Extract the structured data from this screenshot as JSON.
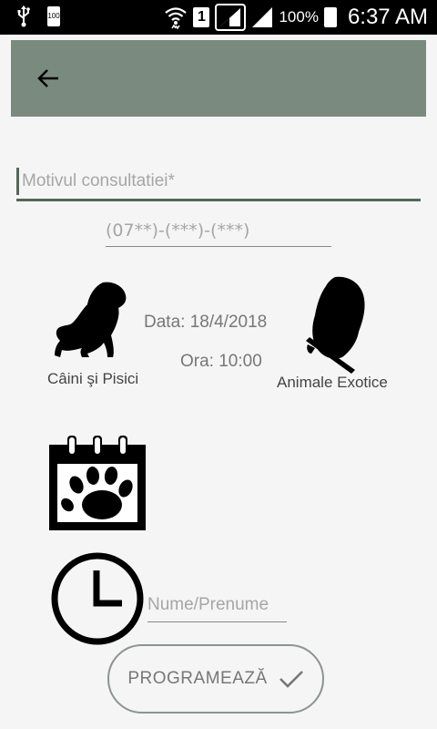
{
  "status_bar": {
    "left_icons": [
      "usb-icon",
      "battery-100-icon"
    ],
    "battery_small_text": "100",
    "sim_number": "1",
    "battery_percent": "100%",
    "time": "6:37 AM"
  },
  "toolbar": {
    "back_icon": "arrow-left-icon",
    "color": "#7b8a7e"
  },
  "form": {
    "reason_placeholder": "Motivul consultatiei*",
    "phone_placeholder": "(07**)-(***)-(***)",
    "name_placeholder": "Nume/Prenume"
  },
  "categories": {
    "dogs_cats": "Câini şi Pisici",
    "exotic": "Animale Exotice"
  },
  "appointment": {
    "date": "Data: 18/4/2018",
    "time": "Ora: 10:00"
  },
  "submit": {
    "label": "PROGRAMEAZĂ"
  },
  "colors": {
    "accent": "#55665a",
    "toolbar": "#7b8a7e"
  }
}
